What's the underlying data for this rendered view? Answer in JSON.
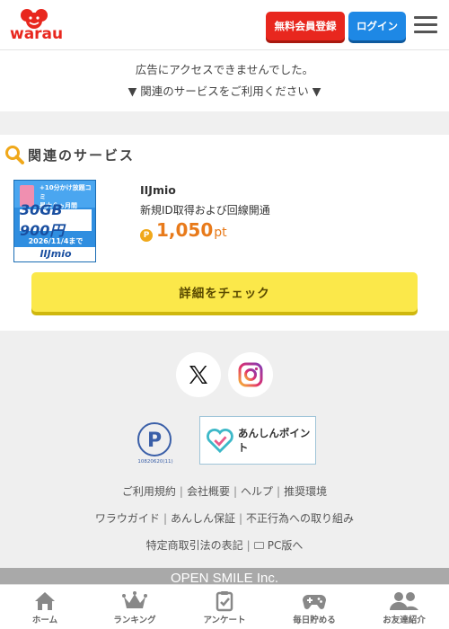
{
  "header": {
    "logo_text": "warau",
    "register_label": "無料会員登録",
    "login_label": "ログイン"
  },
  "ad_notice": {
    "line1": "広告にアクセスできませんでした。",
    "line2": "▼ 関連のサービスをご利用ください ▼"
  },
  "related": {
    "title": "関連のサービス",
    "item": {
      "name": "IIJmio",
      "description": "新規ID取得および回線開通",
      "points": "1,050",
      "unit": "pt",
      "banner": {
        "ribbon_line1": "+10分かけ放題コミ",
        "ribbon_line2": "最大６ヵ月間",
        "big_text": "30GB 900円",
        "date": "2026/11/4まで",
        "brand": "IIJmio"
      }
    },
    "detail_button": "詳細をチェック"
  },
  "footer": {
    "anshin_label": "あんしんポイント",
    "pmark_number": "10820620(11)",
    "links_row1": [
      "ご利用規約",
      "会社概要",
      "ヘルプ",
      "推奨環境"
    ],
    "links_row2": [
      "ワラウガイド",
      "あんしん保証",
      "不正行為への取り組み"
    ],
    "links_row3": [
      "特定商取引法の表記",
      "PC版へ"
    ],
    "copyright": "OPEN SMILE Inc."
  },
  "bottom_nav": [
    {
      "label": "ホーム",
      "icon": "home-icon"
    },
    {
      "label": "ランキング",
      "icon": "crown-icon"
    },
    {
      "label": "アンケート",
      "icon": "survey-icon"
    },
    {
      "label": "毎日貯める",
      "icon": "gamepad-icon"
    },
    {
      "label": "お友達紹介",
      "icon": "friends-icon"
    }
  ],
  "colors": {
    "brand_red": "#e8271e",
    "login_blue": "#1e88e5",
    "detail_yellow": "#fbe84a",
    "points_orange": "#e87a1a"
  }
}
